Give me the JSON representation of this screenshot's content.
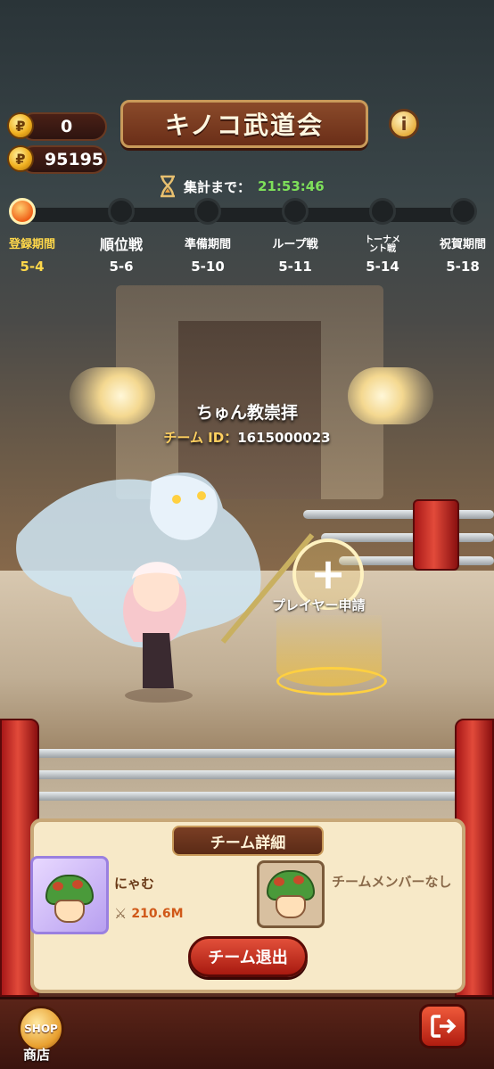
{
  "currency": {
    "ticket_count": "0",
    "coin_count": "95195"
  },
  "title": "キノコ武道会",
  "timer": {
    "label": "集計まで：",
    "value": "21:53:46"
  },
  "phases": [
    {
      "name": "登録期間",
      "date": "5-4"
    },
    {
      "name": "順位戦",
      "date": "5-6"
    },
    {
      "name": "準備期間",
      "date": "5-10"
    },
    {
      "name": "ループ戦",
      "date": "5-11"
    },
    {
      "name": "トーナメント戦",
      "date": "5-14"
    },
    {
      "name": "祝賀期間",
      "date": "5-18"
    }
  ],
  "current_phase_index": 0,
  "player": {
    "name": "ちゅん教崇拝",
    "team_id_label": "チーム ID：",
    "team_id": "1615000023"
  },
  "apply": {
    "label": "プレイヤー申請"
  },
  "team": {
    "title": "チーム詳細",
    "member_name": "にゃむ",
    "member_power": "210.6M",
    "no_member_text": "チームメンバーなし",
    "leave_label": "チーム退出"
  },
  "bottom": {
    "shop_badge": "SHOP",
    "shop_label": "商店"
  },
  "colors": {
    "accent_yellow": "#ffd84a",
    "timer_green": "#7ee05a",
    "leave_red": "#c82a18"
  }
}
